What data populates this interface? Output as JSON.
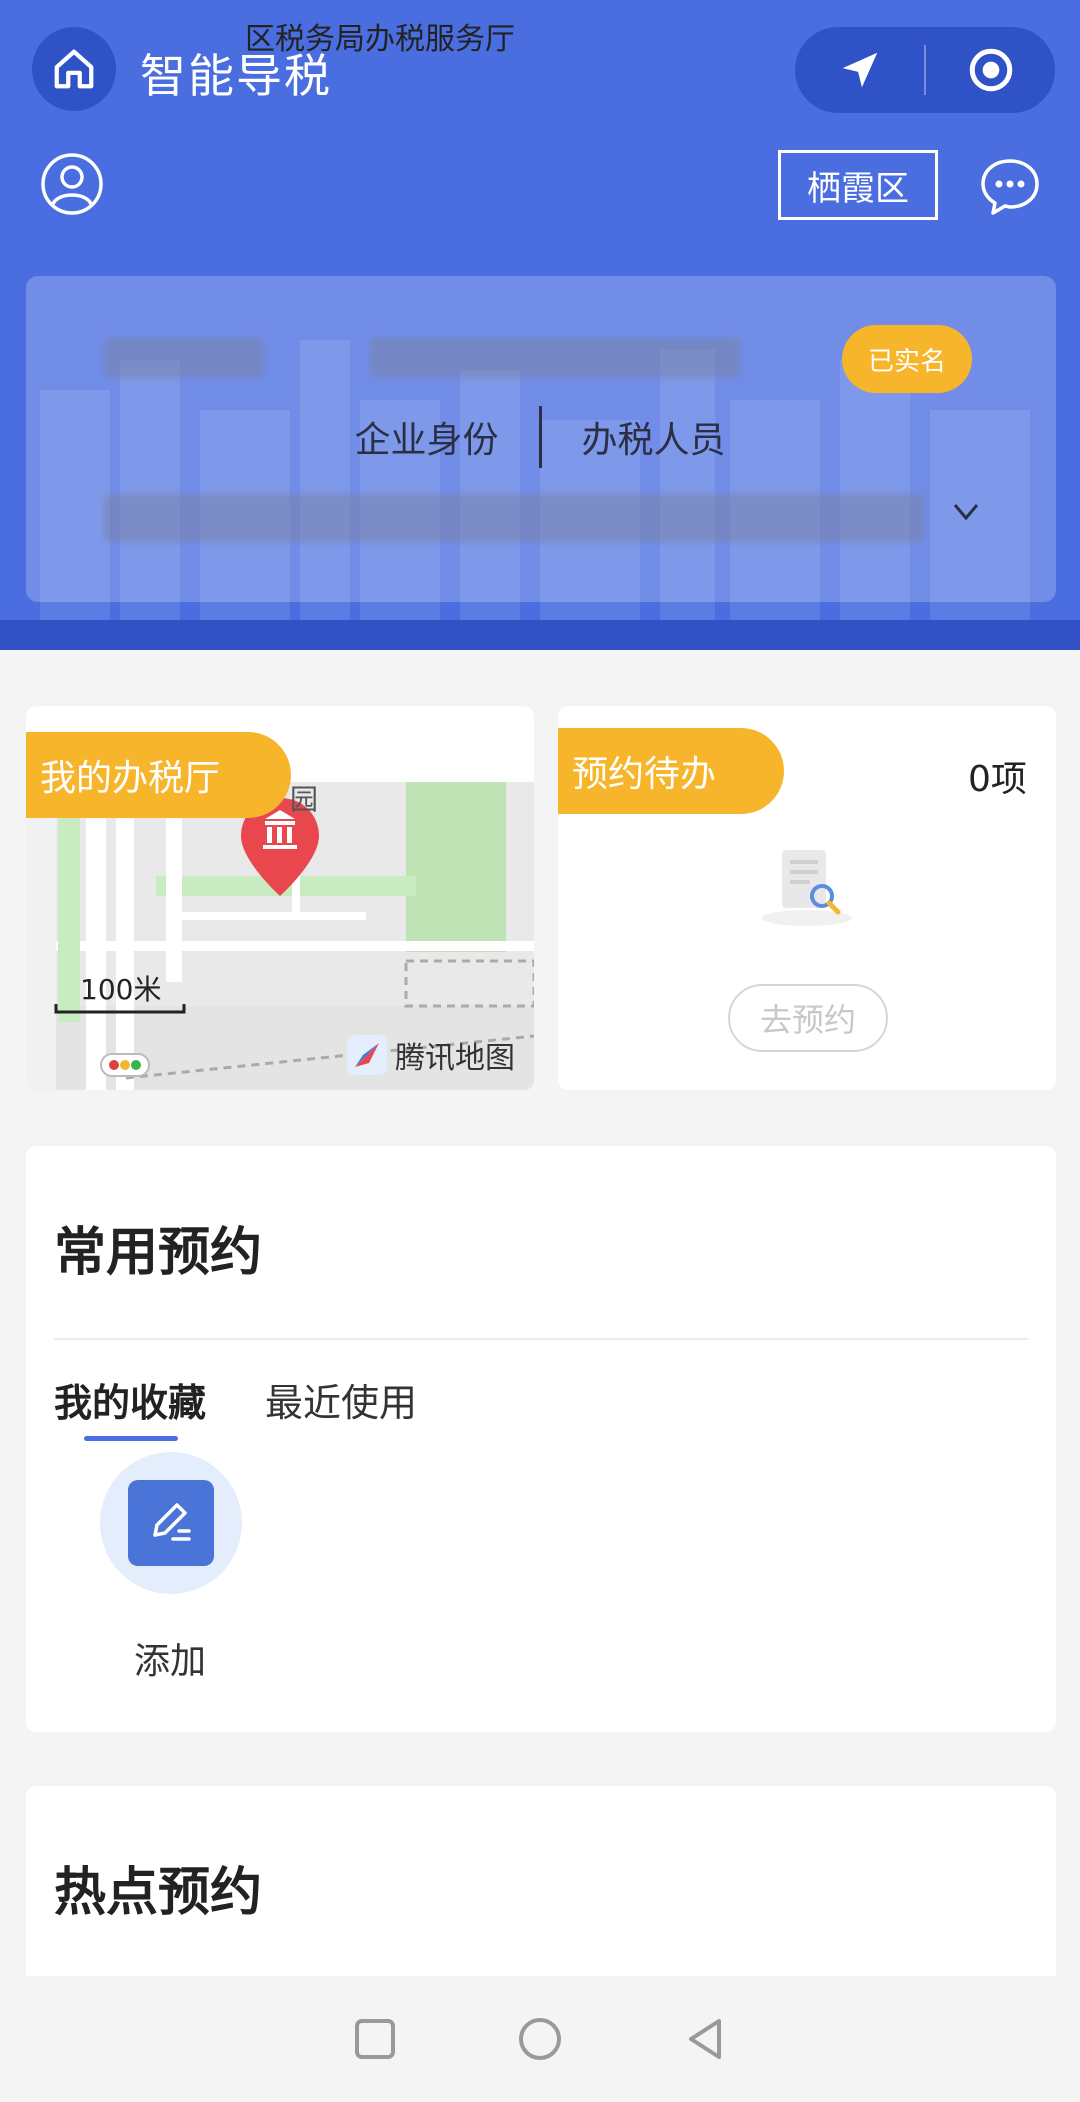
{
  "header": {
    "app_title": "智能导税",
    "district_button": "栖霞区",
    "brand_color": "#4a6ee0"
  },
  "identity": {
    "verified_badge": "已实名",
    "role_left": "企业身份",
    "role_right": "办税人员"
  },
  "map_card": {
    "tag": "我的办税厅",
    "hall_title": "区税务局办税服务厅",
    "park_label": "园",
    "scale_label": "100米",
    "map_provider": "腾讯地图"
  },
  "todo_card": {
    "tag": "预约待办",
    "count": "0项",
    "go_button": "去预约"
  },
  "common": {
    "title": "常用预约",
    "tabs": [
      "我的收藏",
      "最近使用"
    ],
    "add_label": "添加"
  },
  "hot": {
    "title": "热点预约"
  },
  "icons": {
    "home": "home-icon",
    "navigate": "navigation-arrow-icon",
    "record": "target-icon",
    "user": "user-icon",
    "chat": "chat-bubble-icon",
    "add": "edit-pen-icon"
  }
}
